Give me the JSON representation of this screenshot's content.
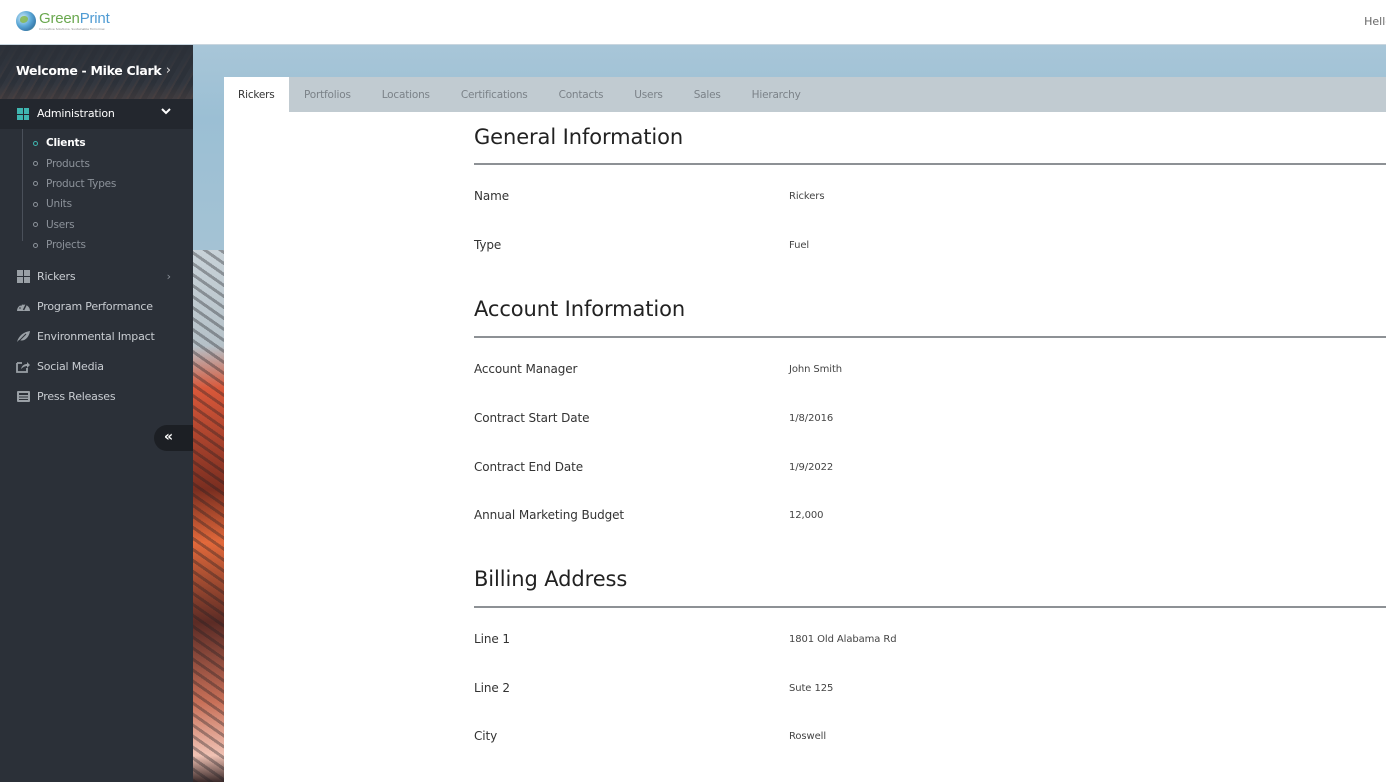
{
  "app": {
    "logo_name_a": "Green",
    "logo_name_b": "Print",
    "logo_tagline": "Innovative Solutions. Sustainable Tomorrow.",
    "greeting": "Hello"
  },
  "sidebar": {
    "welcome": "Welcome - Mike Clark",
    "admin_label": "Administration",
    "admin_items": [
      {
        "label": "Clients",
        "active": true
      },
      {
        "label": "Products"
      },
      {
        "label": "Product Types"
      },
      {
        "label": "Units"
      },
      {
        "label": "Users"
      },
      {
        "label": "Projects"
      }
    ],
    "nav_items": [
      {
        "label": "Rickers",
        "icon": "grid-icon",
        "has_chevron": true
      },
      {
        "label": "Program Performance",
        "icon": "dashboard-gauge-icon"
      },
      {
        "label": "Environmental Impact",
        "icon": "leaf-icon"
      },
      {
        "label": "Social Media",
        "icon": "share-square-icon"
      },
      {
        "label": "Press Releases",
        "icon": "newspaper-icon"
      }
    ],
    "collapse_glyph": "«",
    "accent_color": "#3fb6b0"
  },
  "tabs": [
    {
      "label": "Rickers",
      "active": true
    },
    {
      "label": "Portfolios"
    },
    {
      "label": "Locations"
    },
    {
      "label": "Certifications"
    },
    {
      "label": "Contacts"
    },
    {
      "label": "Users"
    },
    {
      "label": "Sales"
    },
    {
      "label": "Hierarchy"
    }
  ],
  "sections": {
    "general": {
      "title": "General Information",
      "fields": [
        {
          "label": "Name",
          "value": "Rickers"
        },
        {
          "label": "Type",
          "value": "Fuel"
        }
      ]
    },
    "account": {
      "title": "Account Information",
      "fields": [
        {
          "label": "Account Manager",
          "value": "John Smith"
        },
        {
          "label": "Contract Start Date",
          "value": "1/8/2016"
        },
        {
          "label": "Contract End Date",
          "value": "1/9/2022"
        },
        {
          "label": "Annual Marketing Budget",
          "value": "12,000"
        }
      ]
    },
    "billing": {
      "title": "Billing Address",
      "fields": [
        {
          "label": "Line 1",
          "value": "1801 Old Alabama Rd"
        },
        {
          "label": "Line 2",
          "value": "Sute 125"
        },
        {
          "label": "City",
          "value": "Roswell"
        }
      ]
    }
  }
}
